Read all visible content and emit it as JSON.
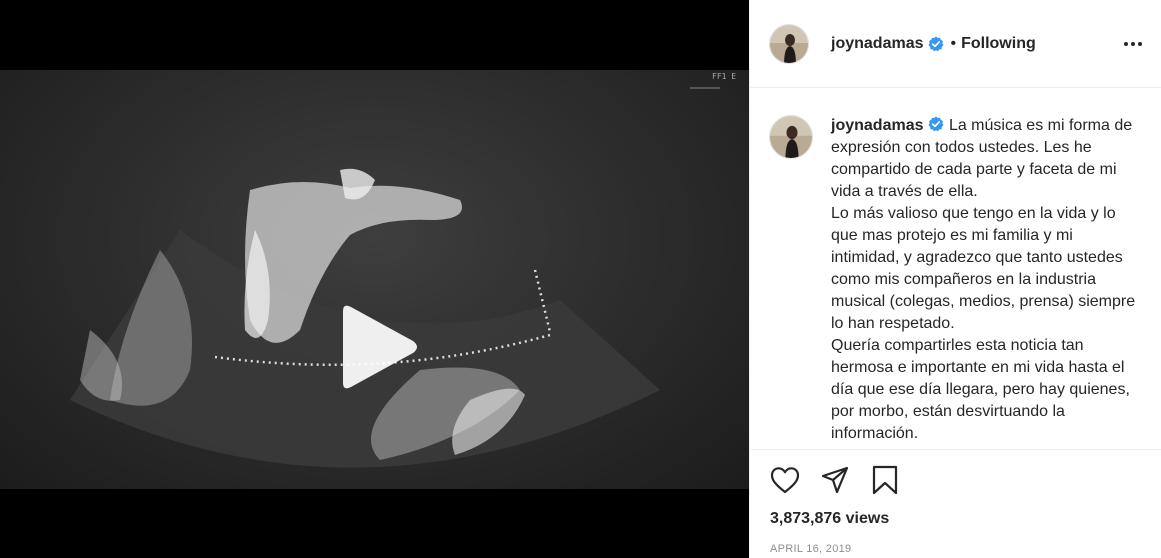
{
  "post": {
    "username": "joynadamas",
    "follow_status": "Following",
    "separator": "•",
    "caption": "La música es mi forma de expresión con todos ustedes. Les he compartido de cada parte y faceta de mi vida a través de ella.\nLo más valioso que tengo en la vida y lo que mas protejo es mi familia y mi intimidad, y agradezco que tanto ustedes como mis compañeros en la industria musical (colegas, medios, prensa) siempre lo han respetado.\nQuería compartirles esta noticia tan hermosa e importante en mi vida hasta el día que ese día llegara, pero hay quienes, por morbo, están desvirtuando la información.",
    "views": "3,873,876 views",
    "date": "APRIL 16, 2019"
  },
  "icons": {
    "verified": "verified-badge-icon",
    "more": "more-options-icon",
    "like": "heart-icon",
    "share": "paper-plane-icon",
    "save": "bookmark-icon",
    "play": "play-icon"
  },
  "colors": {
    "verified_blue": "#3897f0",
    "text": "#262626",
    "muted": "#8e8e8e",
    "divider": "#efefef"
  }
}
